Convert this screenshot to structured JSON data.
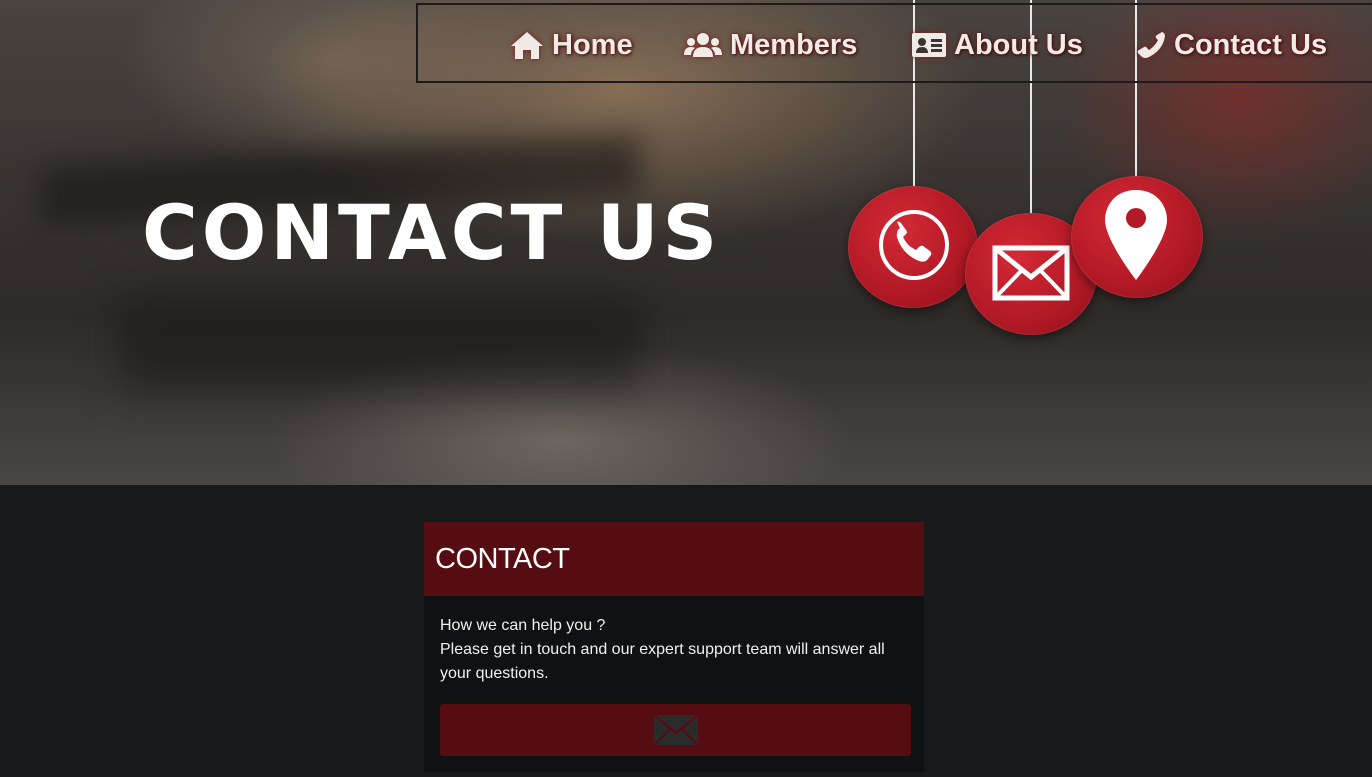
{
  "nav": {
    "items": [
      {
        "label": "Home",
        "icon": "home-icon"
      },
      {
        "label": "Members",
        "icon": "users-icon"
      },
      {
        "label": "About Us",
        "icon": "id-card-icon"
      },
      {
        "label": "Contact Us",
        "icon": "phone-icon"
      }
    ]
  },
  "hero": {
    "title": "CONTACT US",
    "ornaments": [
      "phone-icon",
      "envelope-icon",
      "map-pin-icon"
    ]
  },
  "contact_card": {
    "title": "CONTACT",
    "line1": "How we can help you ?",
    "line2": "Please get in touch and our expert support team will answer all your questions.",
    "button_icon": "envelope-icon"
  },
  "colors": {
    "brand_red": "#560d12",
    "ornament_red": "#c0202c",
    "page_background": "#18191b"
  }
}
